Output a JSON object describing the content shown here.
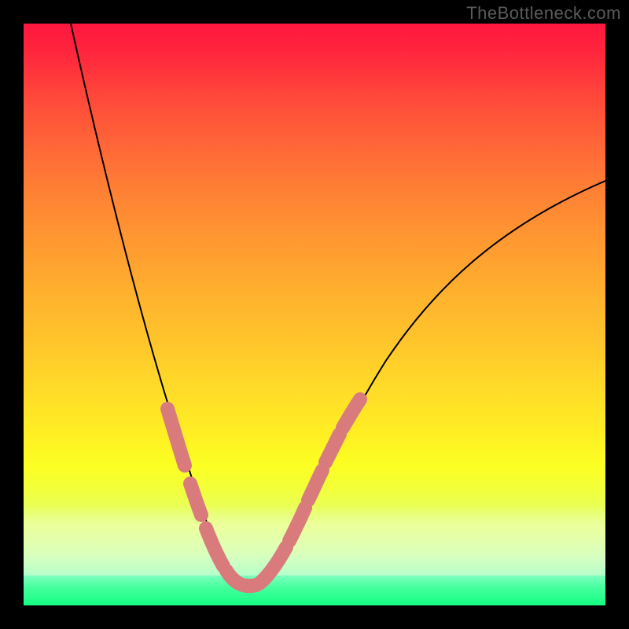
{
  "watermark": "TheBottleneck.com",
  "colors": {
    "background": "#000000",
    "curve": "#000000",
    "highlight": "#d97b7d",
    "gradient_top": "#ff163e",
    "gradient_bottom": "#06ff7b"
  },
  "chart_data": {
    "type": "line",
    "title": "",
    "xlabel": "",
    "ylabel": "",
    "xlim": [
      0,
      100
    ],
    "ylim": [
      0,
      100
    ],
    "grid": false,
    "legend": false,
    "x": [
      8,
      10,
      12,
      14,
      16,
      18,
      20,
      22,
      24,
      26,
      28,
      30,
      32,
      34,
      35.5,
      36.5,
      38,
      40,
      42,
      44,
      46,
      48,
      52,
      56,
      60,
      65,
      70,
      75,
      80,
      85,
      90,
      95,
      100
    ],
    "y": [
      100,
      93,
      86,
      79,
      72,
      65,
      58,
      51,
      44,
      37,
      30,
      23,
      17,
      11,
      6,
      4,
      3,
      3,
      4,
      7,
      12,
      17,
      25,
      32,
      38,
      44,
      50,
      55,
      59,
      63,
      67,
      70,
      73
    ],
    "highlight_segments_x": [
      [
        24,
        26.5
      ],
      [
        27.5,
        29
      ],
      [
        30,
        33
      ],
      [
        33.5,
        41
      ],
      [
        41.5,
        44.5
      ],
      [
        44.8,
        46.8
      ],
      [
        47.2,
        48.8
      ],
      [
        49.2,
        50.8
      ],
      [
        51.2,
        53
      ]
    ],
    "notes": "V-shaped bottleneck curve over a red-to-green vertical gradient; values are read off the curve geometry (no axes shown)."
  }
}
